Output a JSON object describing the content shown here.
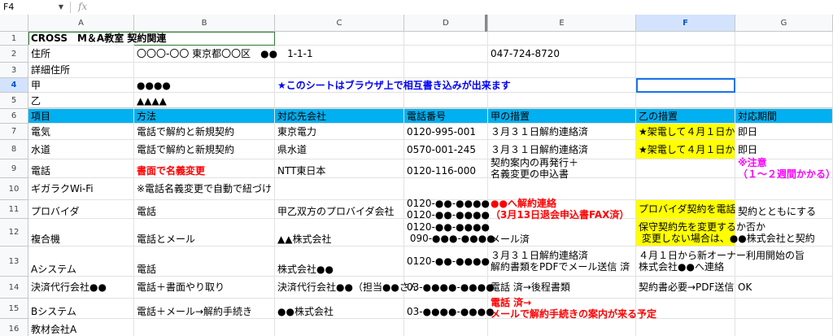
{
  "formula_bar": {
    "name_box": "F4",
    "fx_label": "fx",
    "formula": ""
  },
  "columns": [
    "A",
    "B",
    "C",
    "D",
    "E",
    "F",
    "G"
  ],
  "rows": [
    "1",
    "2",
    "3",
    "4",
    "5",
    "6",
    "7",
    "8",
    "9",
    "10",
    "11",
    "12",
    "13",
    "14",
    "15",
    "16"
  ],
  "cells": {
    "A1": "CROSS　M＆A教室 契約関連",
    "A2": "住所",
    "B2": "〇〇〇-〇〇 東京都〇〇区　●●　1-1-1",
    "E2": "047-724-8720",
    "A3": "詳細住所",
    "A4": "甲",
    "B4": "●●●●",
    "C4": "★このシートはブラウザ上で相互書き込みが出来ます",
    "A5": "乙",
    "B5": "▲▲▲▲",
    "A6": "項目",
    "B6": "方法",
    "C6": "対応先会社",
    "D6": "電話番号",
    "E6": "甲の措置",
    "F6": "乙の措置",
    "G6": "対応期間",
    "A7": "電気",
    "B7": "電話で解約と新規契約",
    "C7": "東京電力",
    "D7": "0120-995-001",
    "E7": "３月３１日解約連絡済",
    "F7": "★架電して４月１日か",
    "G7": "即日",
    "A8": "水道",
    "B8": "電話で解約と新規契約",
    "C8": "県水道",
    "D8": "0570-001-245",
    "E8": "３月３１日解約連絡済",
    "F8": "★架電して４月１日か",
    "G8": "即日",
    "A9": "電話",
    "B9": "書面で名義変更",
    "C9": "NTT東日本",
    "D9": "0120-116-000",
    "E9": "契約案内の再発行＋\n名義変更の申込書",
    "G9": "※注意\n（１～２週間かかる）",
    "A10": "ギガラクWi-Fi",
    "B10": "※電話名義変更で自動で紐づけ",
    "A11": "プロバイダ",
    "B11": "電話",
    "C11": "甲乙双方のプロバイダ会社",
    "D11": "0120-●●-●●●●\n0120-●●-●●●●",
    "E11": "●●へ解約連絡\n（3月13日退会申込書FAX済）",
    "F11": "プロバイダ契約を電話",
    "G11": "契約とともにする",
    "A12": "複合機",
    "B12": "電話とメール",
    "C12": "▲▲株式会社",
    "D12": "0120-●●-●●●●\n 090-●●●-●●●●",
    "E12": "メール済",
    "F12": "保守契約先を変更するか否か\n 変更しない場合は、●●株式会社と契約",
    "A13": "Aシステム",
    "B13": "電話",
    "C13": "株式会社●●",
    "D13": "0120-●●-●●●●",
    "E13": "３月３１日解約連絡済\n解約書類をPDFでメール送信 済",
    "F13": "４月１日から新オーナー利用開始の旨\n株式会社●●へ連絡",
    "A14": "決済代行会社●●",
    "B14": "電話＋書面やり取り",
    "C14": "決済代行会社●●（担当●●さん",
    "D14": "03-●●●●-●●●●",
    "E14": "電話 済→後程書類",
    "F14": "契約書必要→PDF送信",
    "G14": "OK",
    "A15": "Bシステム",
    "B15": "電話＋メール→解約手続き",
    "C15": "●●株式会社",
    "D15": "03-●●●●-●●●●",
    "E15": "電話 済→\nメールで解約手続きの案内が来る予定",
    "A16": "教材会社A"
  },
  "colors": {
    "header_row": "#00b0f0",
    "highlight": "#ffff00",
    "selection": "#1a73e8",
    "warning_text": "#ff0000",
    "notice_text": "#0000ff",
    "caution_text": "#ff00ff"
  }
}
